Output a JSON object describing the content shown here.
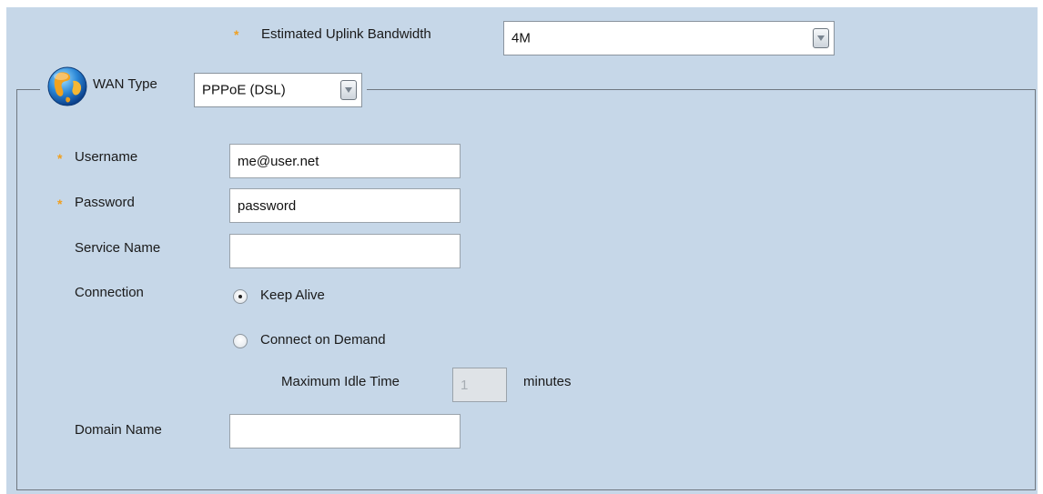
{
  "bandwidth": {
    "label": "Estimated Uplink Bandwidth",
    "value": "4M"
  },
  "wan": {
    "label": "WAN Type",
    "value": "PPPoE (DSL)",
    "icon": "globe-icon"
  },
  "fields": {
    "username": {
      "label": "Username",
      "value": "me@user.net"
    },
    "password": {
      "label": "Password",
      "value": "password"
    },
    "service_name": {
      "label": "Service Name",
      "value": ""
    },
    "connection": {
      "label": "Connection",
      "options": [
        "Keep Alive",
        "Connect on Demand"
      ],
      "selected": "Keep Alive"
    },
    "max_idle": {
      "label": "Maximum Idle Time",
      "value": "1",
      "unit": "minutes"
    },
    "domain_name": {
      "label": "Domain Name",
      "value": ""
    }
  },
  "colors": {
    "panel_bg": "#c6d7e8",
    "required_star": "#f0a020"
  }
}
